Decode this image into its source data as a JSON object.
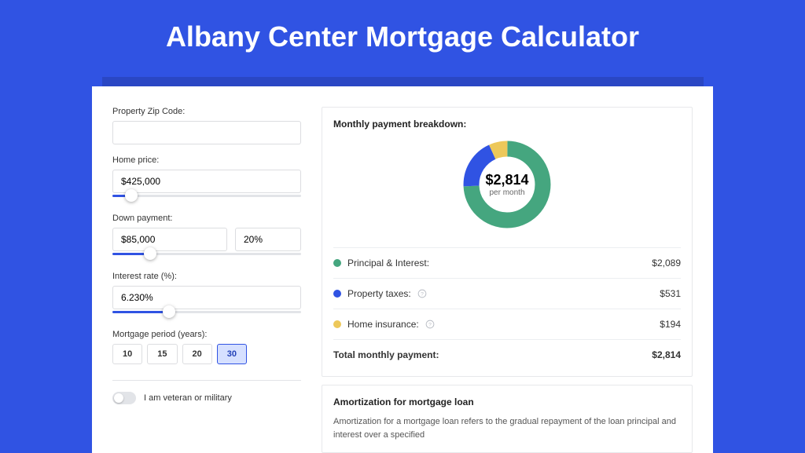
{
  "hero": {
    "title": "Albany Center Mortgage Calculator"
  },
  "form": {
    "zip_label": "Property Zip Code:",
    "zip_value": "",
    "home_price_label": "Home price:",
    "home_price_value": "$425,000",
    "home_price_slider_pct": 10,
    "down_payment_label": "Down payment:",
    "down_payment_amount": "$85,000",
    "down_payment_pct": "20%",
    "down_payment_slider_pct": 20,
    "interest_label": "Interest rate (%):",
    "interest_value": "6.230%",
    "interest_slider_pct": 30,
    "period_label": "Mortgage period (years):",
    "periods": [
      "10",
      "15",
      "20",
      "30"
    ],
    "period_active": 3,
    "veteran_label": "I am veteran or military",
    "veteran_on": false
  },
  "breakdown": {
    "title": "Monthly payment breakdown:",
    "center_amount": "$2,814",
    "center_unit": "per month",
    "items": [
      {
        "label": "Principal & Interest:",
        "value": "$2,089",
        "color": "#45a67f",
        "info": false
      },
      {
        "label": "Property taxes:",
        "value": "$531",
        "color": "#3053e3",
        "info": true
      },
      {
        "label": "Home insurance:",
        "value": "$194",
        "color": "#edc85a",
        "info": true
      }
    ],
    "total_label": "Total monthly payment:",
    "total_value": "$2,814"
  },
  "amortization": {
    "title": "Amortization for mortgage loan",
    "paragraph": "Amortization for a mortgage loan refers to the gradual repayment of the loan principal and interest over a specified"
  },
  "chart_data": {
    "type": "pie",
    "title": "Monthly payment breakdown",
    "unit": "USD",
    "series": [
      {
        "name": "Principal & Interest",
        "value": 2089,
        "color": "#45a67f"
      },
      {
        "name": "Property taxes",
        "value": 531,
        "color": "#3053e3"
      },
      {
        "name": "Home insurance",
        "value": 194,
        "color": "#edc85a"
      }
    ],
    "total": 2814
  }
}
